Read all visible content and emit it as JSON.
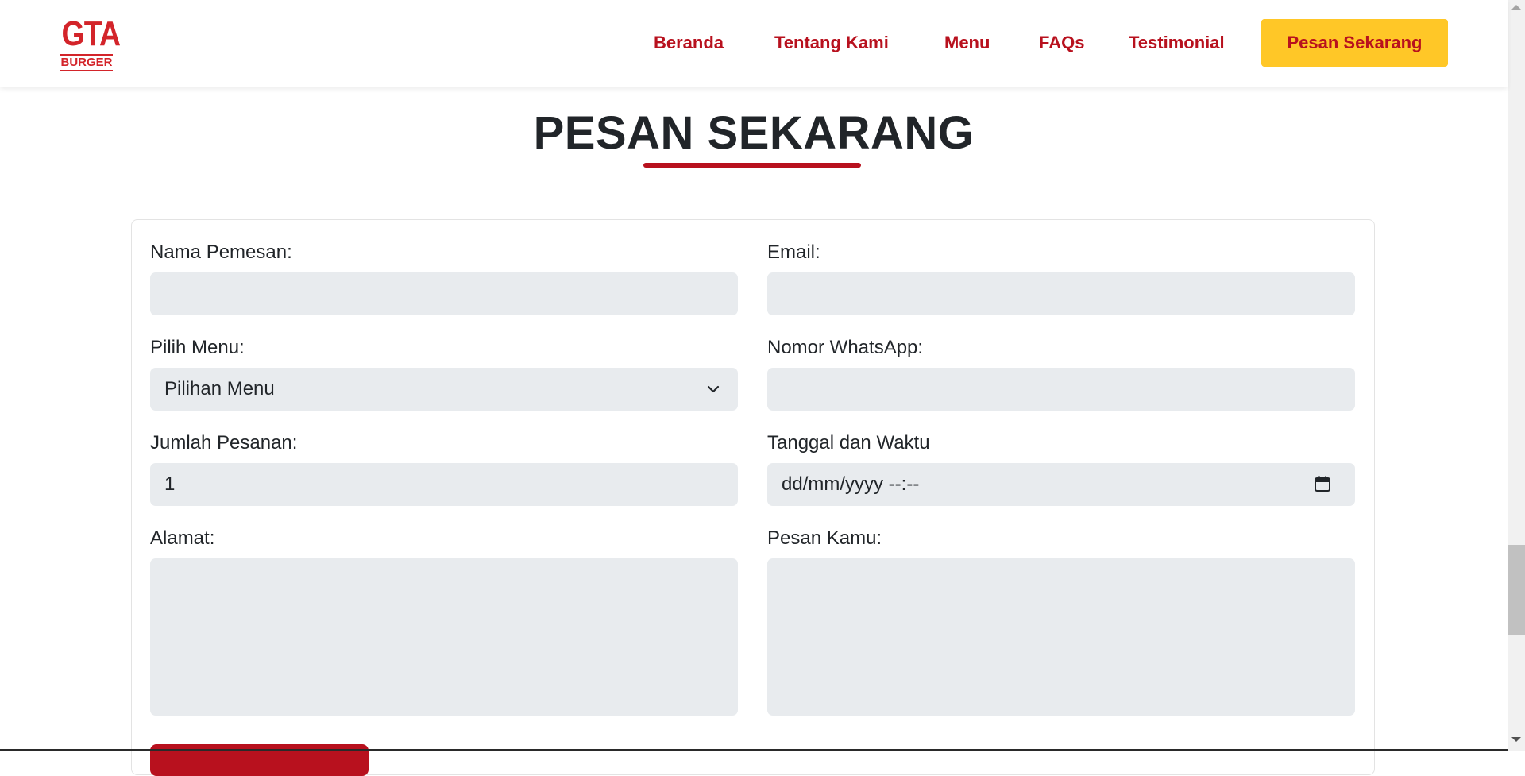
{
  "brand": {
    "logo_main": "GTA",
    "logo_sub": "BURGER",
    "primary_color": "#b8111e",
    "accent_color": "#ffc727"
  },
  "nav": {
    "items": [
      {
        "label": "Beranda"
      },
      {
        "label": "Tentang Kami"
      },
      {
        "label": "Menu"
      },
      {
        "label": "FAQs"
      },
      {
        "label": "Testimonial"
      }
    ],
    "cta_label": "Pesan Sekarang"
  },
  "section": {
    "title": "PESAN SEKARANG"
  },
  "form": {
    "name_label": "Nama Pemesan:",
    "name_value": "",
    "email_label": "Email:",
    "email_value": "",
    "menu_label": "Pilih Menu:",
    "menu_selected": "Pilihan Menu",
    "whatsapp_label": "Nomor WhatsApp:",
    "whatsapp_value": "",
    "quantity_label": "Jumlah Pesanan:",
    "quantity_value": "1",
    "datetime_label": "Tanggal dan Waktu",
    "datetime_placeholder": "dd/mm/yyyy --:--",
    "address_label": "Alamat:",
    "address_value": "",
    "message_label": "Pesan Kamu:",
    "message_value": ""
  },
  "icons": {
    "select": "chevron-down-icon",
    "datetime": "calendar-icon"
  },
  "input_background": "#e8ebee"
}
